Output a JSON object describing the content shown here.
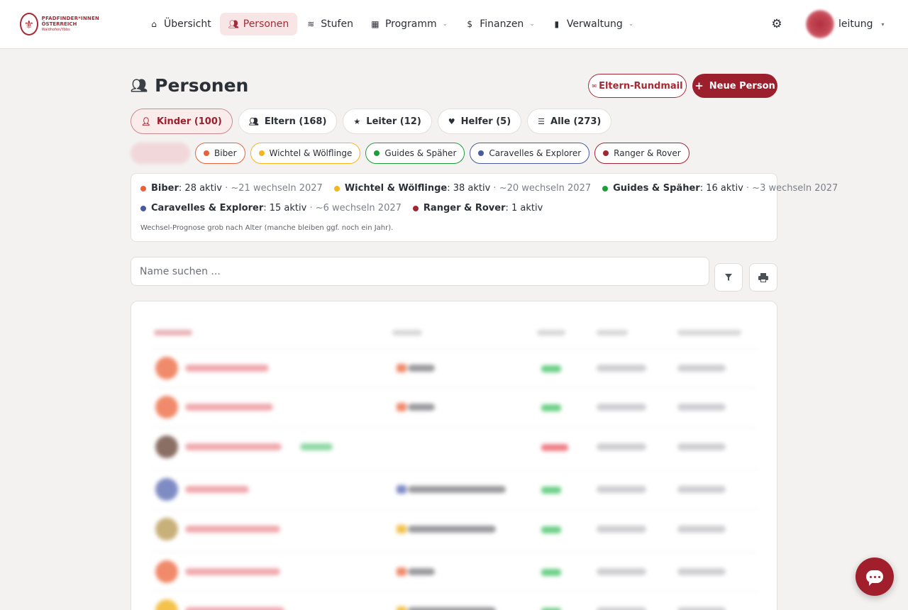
{
  "brand": {
    "line1": "PFADFINDER*INNEN",
    "line2": "ÖSTERREICH",
    "line3": "Waldhofen/Ybbs",
    "logo_icon": "fleur-de-lis-icon",
    "color": "#a52a35"
  },
  "nav": {
    "items": [
      {
        "label": "Übersicht",
        "icon": "home-icon",
        "active": false,
        "dropdown": false
      },
      {
        "label": "Personen",
        "icon": "users-icon",
        "active": true,
        "dropdown": false
      },
      {
        "label": "Stufen",
        "icon": "layers-icon",
        "active": false,
        "dropdown": false
      },
      {
        "label": "Programm",
        "icon": "calendar-icon",
        "active": false,
        "dropdown": true
      },
      {
        "label": "Finanzen",
        "icon": "dollar-icon",
        "active": false,
        "dropdown": true
      },
      {
        "label": "Verwaltung",
        "icon": "clipboard-icon",
        "active": false,
        "dropdown": true
      }
    ],
    "settings_icon": "gear-icon",
    "user_name": "leitung"
  },
  "header": {
    "title": "Personen",
    "mail_button": "Eltern-Rundmail",
    "new_button": "Neue Person",
    "primary_color": "#9b1f2c"
  },
  "roles": [
    {
      "label": "Kinder (100)",
      "icon": "user-icon",
      "active": true
    },
    {
      "label": "Eltern (168)",
      "icon": "users-icon",
      "active": false
    },
    {
      "label": "Leiter (12)",
      "icon": "star-icon",
      "active": false
    },
    {
      "label": "Helfer (5)",
      "icon": "heart-icon",
      "active": false
    },
    {
      "label": "Alle (273)",
      "icon": "list-icon",
      "active": false
    }
  ],
  "levels": [
    {
      "label": "Biber",
      "color": "#e8623a"
    },
    {
      "label": "Wichtel & Wölflinge",
      "color": "#f3b61f"
    },
    {
      "label": "Guides & Späher",
      "color": "#1e9e3a"
    },
    {
      "label": "Caravelles & Explorer",
      "color": "#4a5a9c"
    },
    {
      "label": "Ranger & Rover",
      "color": "#a32432"
    }
  ],
  "summary": {
    "row1": [
      {
        "name": "Biber",
        "active": ": 28 aktiv",
        "forecast": " · ~21 wechseln 2027",
        "color": "#e8623a"
      },
      {
        "name": "Wichtel & Wölflinge",
        "active": ": 38 aktiv",
        "forecast": " · ~20 wechseln 2027",
        "color": "#f3b61f"
      },
      {
        "name": "Guides & Späher",
        "active": ": 16 aktiv",
        "forecast": " · ~3 wechseln 2027",
        "color": "#1e9e3a"
      }
    ],
    "row2": [
      {
        "name": "Caravelles & Explorer",
        "active": ": 15 aktiv",
        "forecast": " · ~6 wechseln 2027",
        "color": "#4a5a9c"
      },
      {
        "name": "Ranger & Rover",
        "active": ": 1 aktiv",
        "forecast": "",
        "color": "#a32432"
      }
    ],
    "note": "Wechsel-Prognose grob nach Alter (manche bleiben ggf. noch ein Jahr)."
  },
  "search": {
    "placeholder": "Name suchen ..."
  },
  "toolbar": {
    "filter_icon": "filter-icon",
    "print_icon": "printer-icon"
  },
  "chat": {
    "icon": "chat-bubble-icon"
  }
}
